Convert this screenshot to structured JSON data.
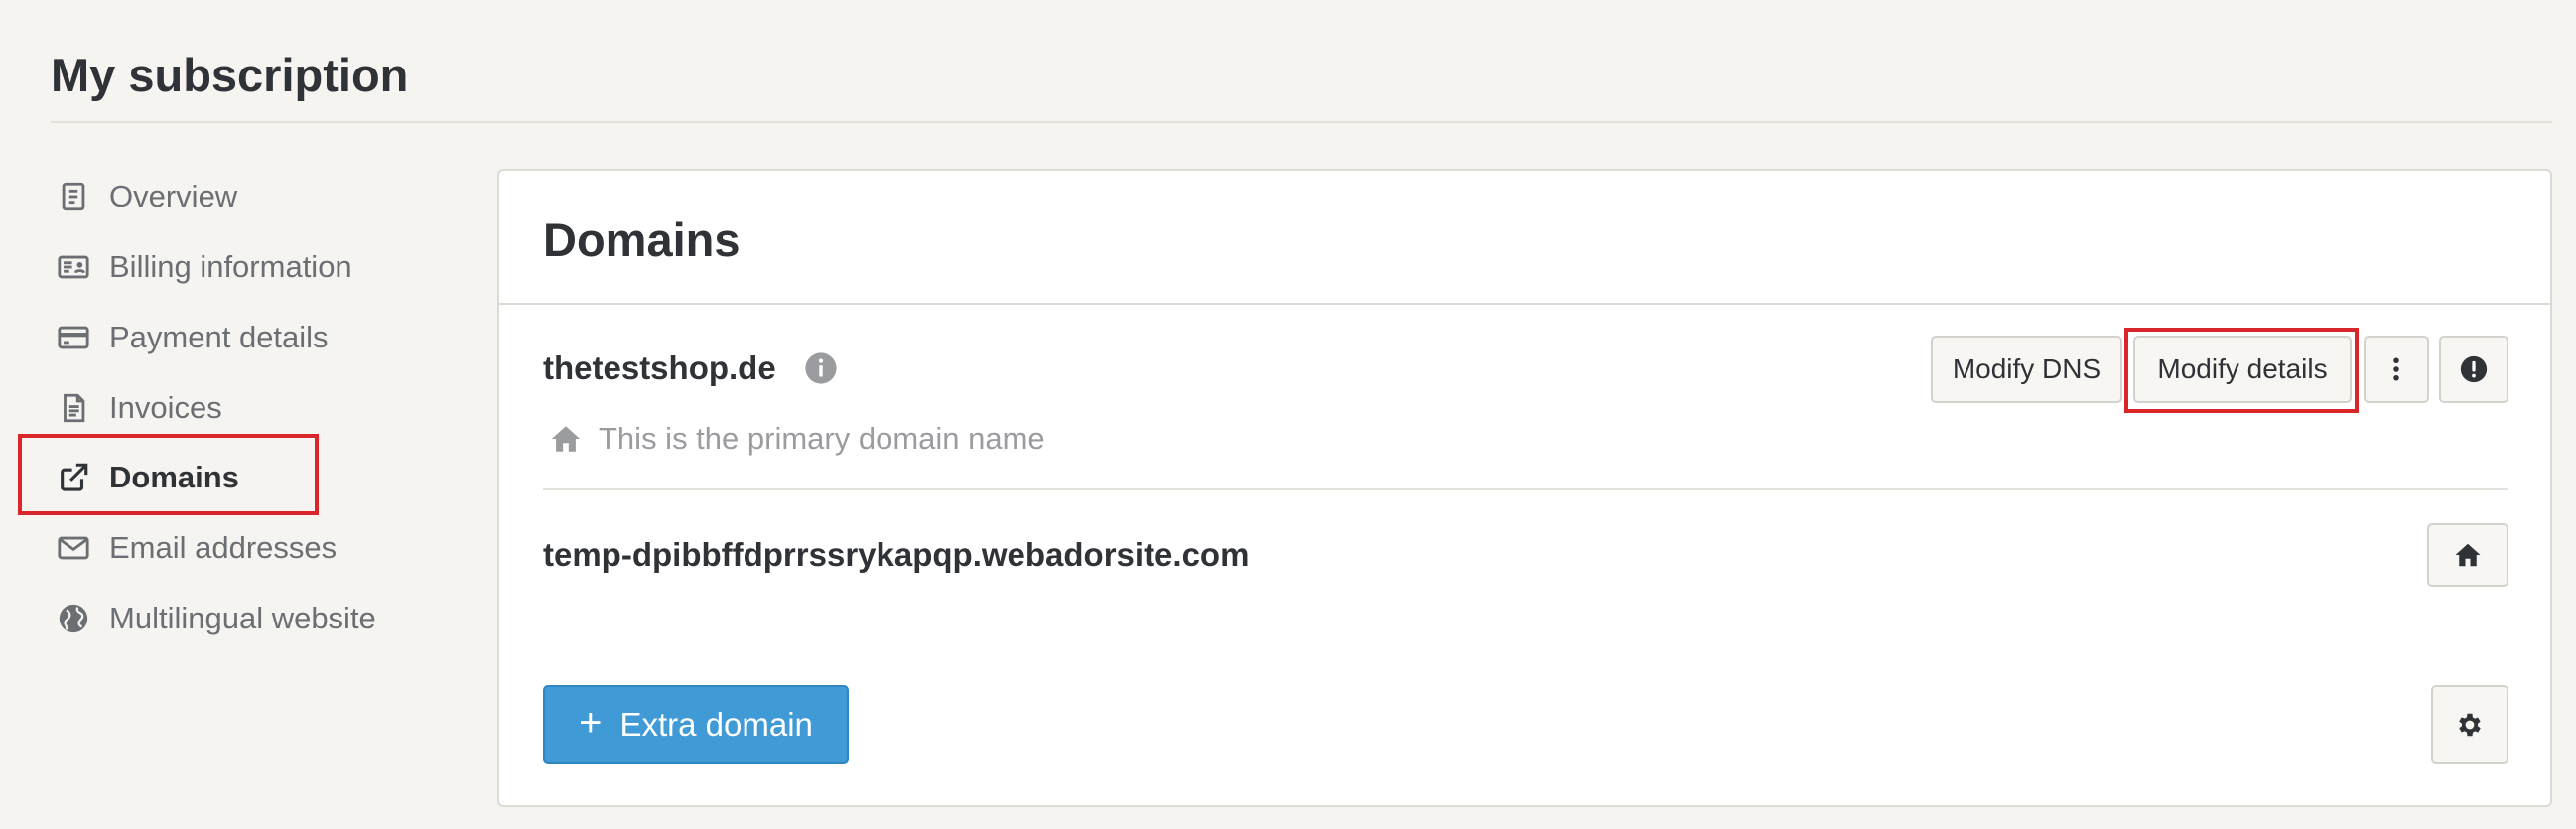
{
  "page": {
    "title": "My subscription"
  },
  "sidebar": {
    "items": [
      {
        "label": "Overview",
        "icon": "document-icon",
        "active": false
      },
      {
        "label": "Billing information",
        "icon": "id-card-icon",
        "active": false
      },
      {
        "label": "Payment details",
        "icon": "credit-card-icon",
        "active": false
      },
      {
        "label": "Invoices",
        "icon": "invoice-icon",
        "active": false
      },
      {
        "label": "Domains",
        "icon": "external-link-icon",
        "active": true
      },
      {
        "label": "Email addresses",
        "icon": "envelope-icon",
        "active": false
      },
      {
        "label": "Multilingual website",
        "icon": "globe-icon",
        "active": false
      }
    ]
  },
  "domains": {
    "title": "Domains",
    "primary": {
      "name": "thetestshop.de",
      "note": "This is the primary domain name",
      "buttons": {
        "modify_dns": "Modify DNS",
        "modify_details": "Modify details"
      }
    },
    "secondary": {
      "name": "temp-dpibbffdprrssrykapqp.webadorsite.com"
    },
    "add_button": {
      "plus": "+",
      "label": "Extra domain"
    }
  },
  "colors": {
    "background": "#f5f4f0",
    "card": "#ffffff",
    "primary_button": "#3f9ad6",
    "highlight": "#d9262b",
    "text": "#2f3236",
    "muted_text": "#6b6e72"
  }
}
